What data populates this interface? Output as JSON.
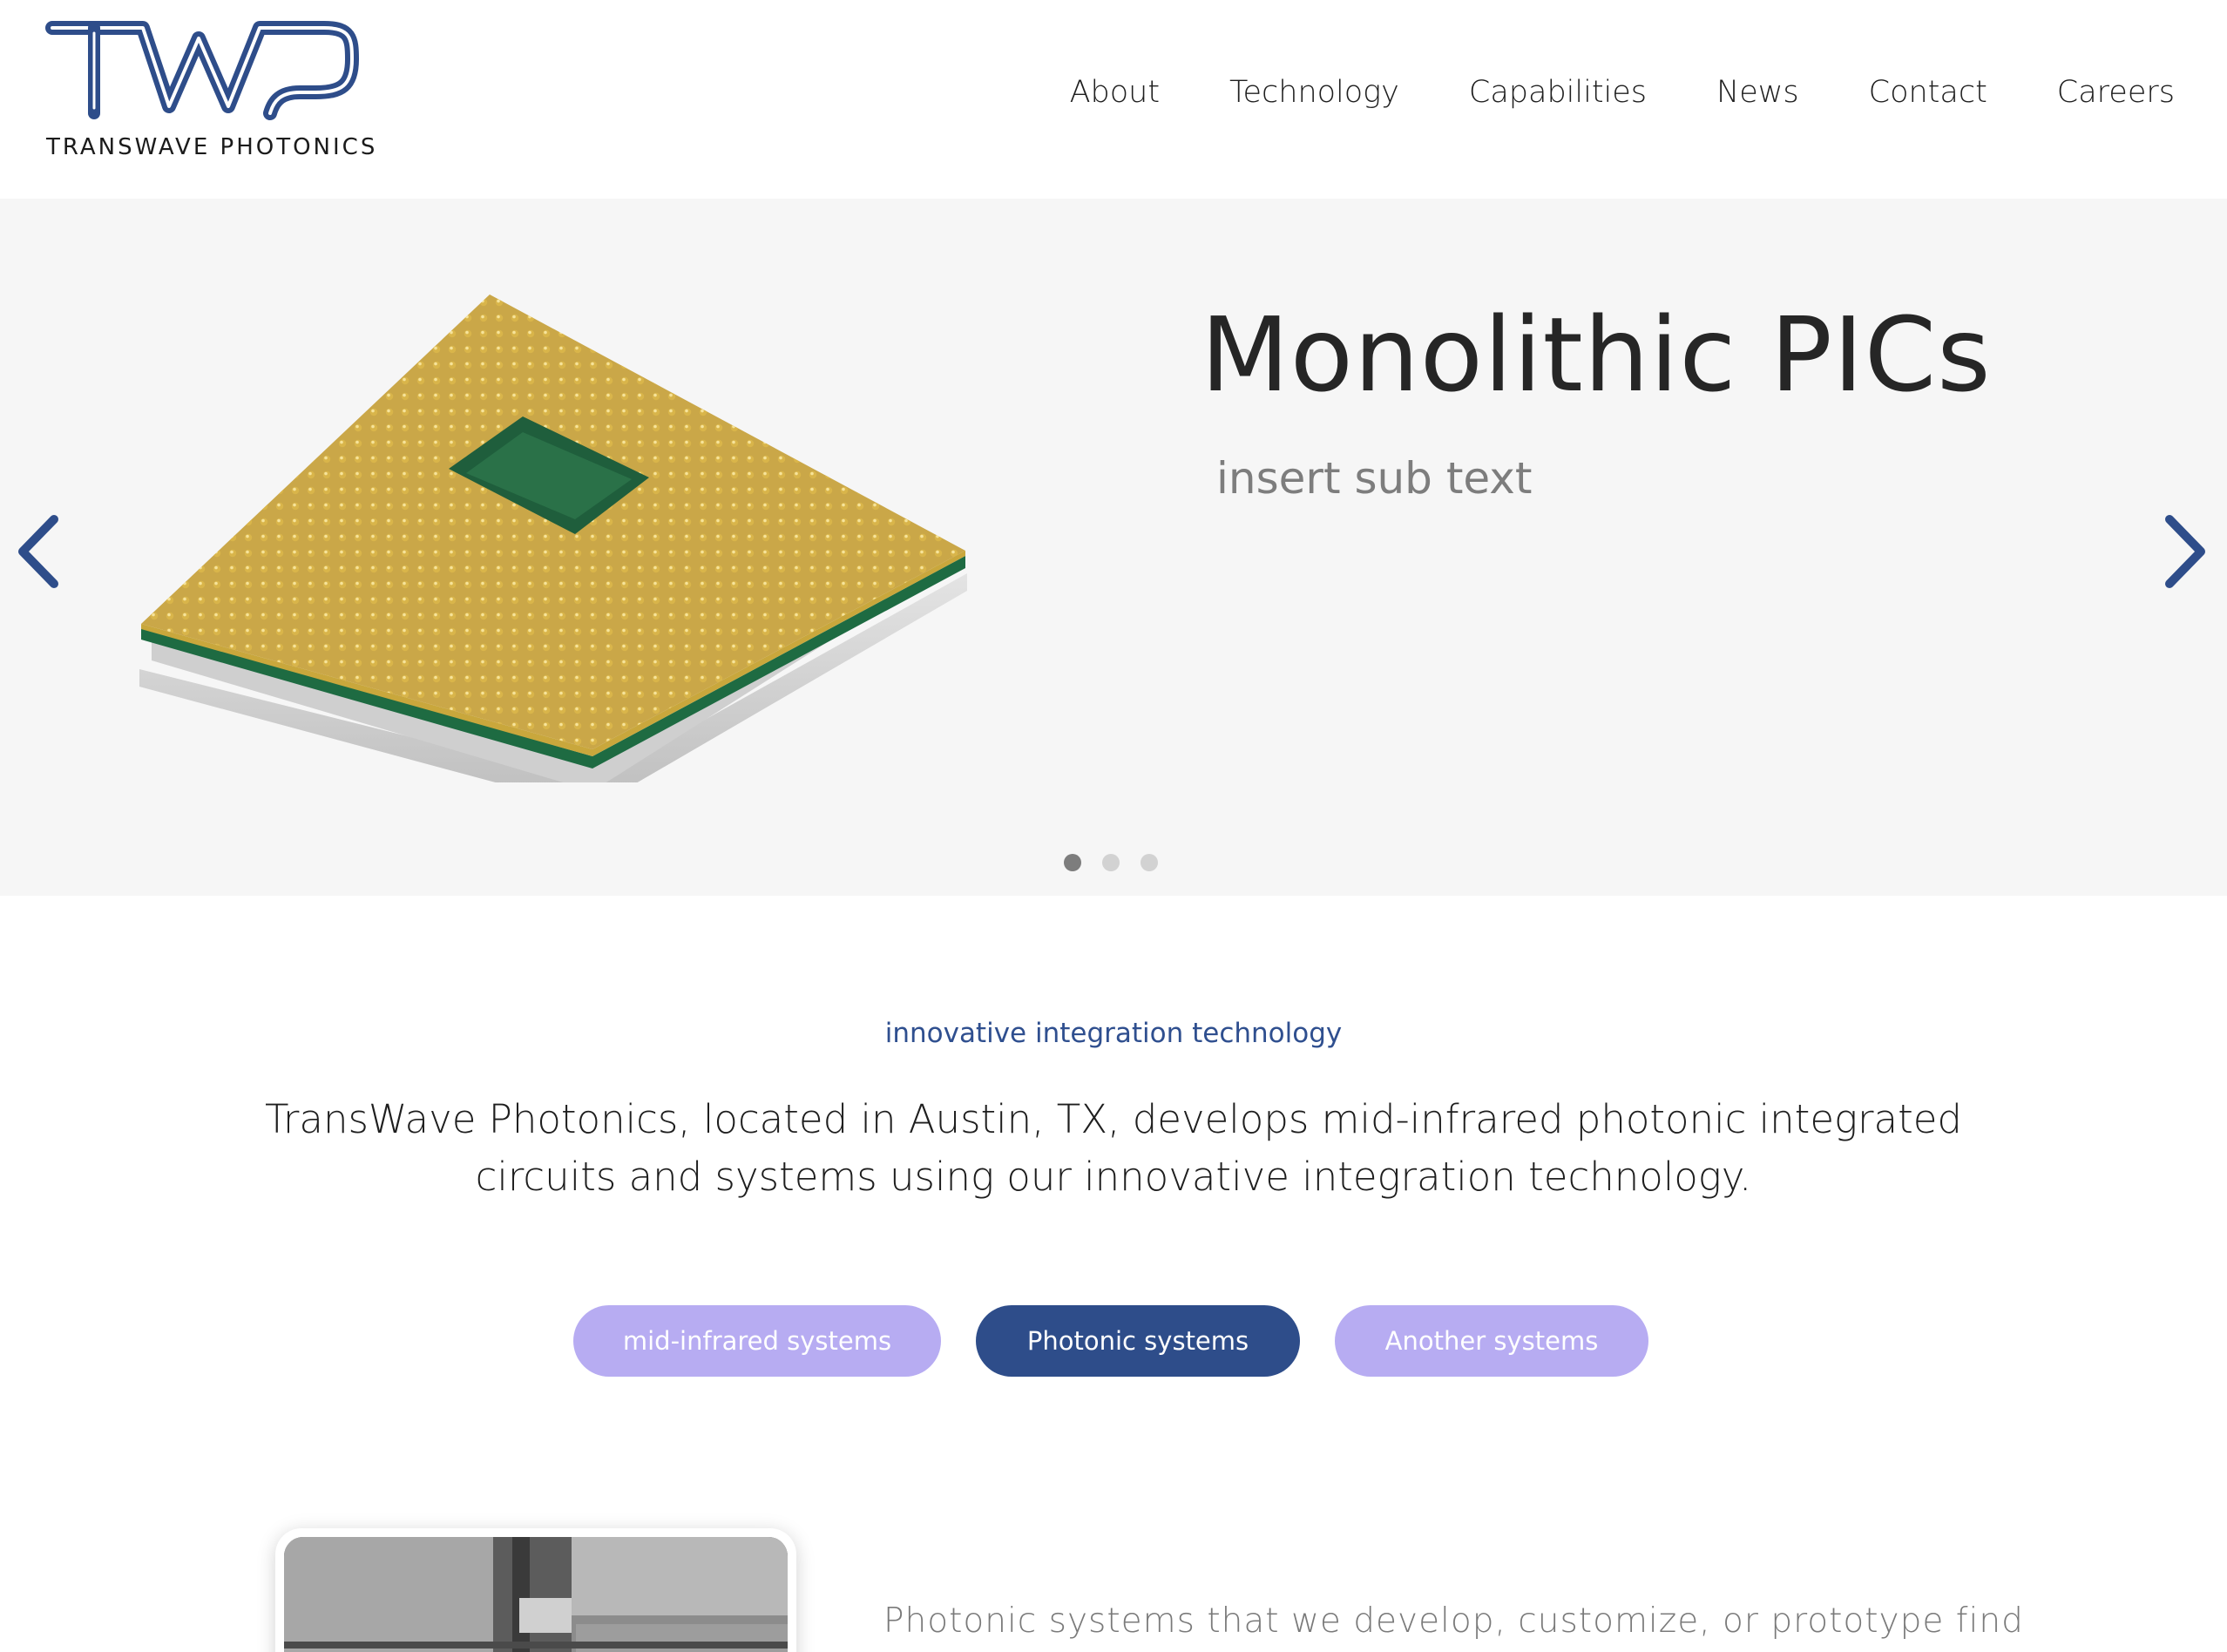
{
  "header": {
    "logo_letters": "TWP",
    "logo_text": "TRANSWAVE PHOTONICS",
    "nav": [
      {
        "label": "About"
      },
      {
        "label": "Technology"
      },
      {
        "label": "Capabilities"
      },
      {
        "label": "News"
      },
      {
        "label": "Contact"
      },
      {
        "label": "Careers"
      }
    ]
  },
  "hero": {
    "title": "Monolithic PICs",
    "subtitle": "insert sub text",
    "prev_icon": "chevron-left-icon",
    "next_icon": "chevron-right-icon",
    "slide_count": 3,
    "active_slide": 1
  },
  "intro": {
    "tag": "innovative integration technology",
    "text": "TransWave Photonics, located in Austin, TX, develops mid-infrared photonic integrated circuits and systems using our innovative integration technology."
  },
  "pills": [
    {
      "label": "mid-infrared systems"
    },
    {
      "label": "Photonic systems"
    },
    {
      "label": "Another systems"
    }
  ],
  "section": {
    "text": "Photonic systems that we develop, customize, or prototype find"
  },
  "colors": {
    "brand_blue": "#2e4d8a",
    "pill_lavender": "#b7acf2",
    "hero_bg": "#f6f6f6"
  }
}
